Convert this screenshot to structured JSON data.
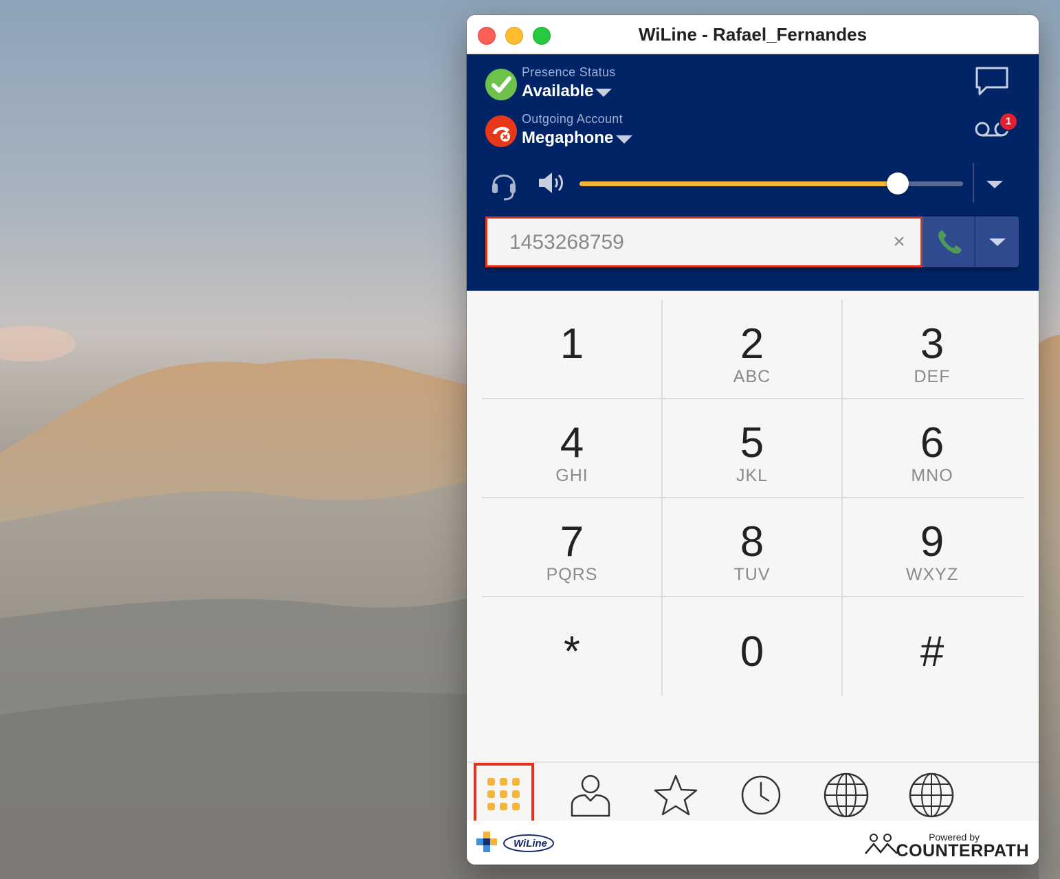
{
  "window": {
    "title": "WiLine - Rafael_Fernandes"
  },
  "presence": {
    "label": "Presence Status",
    "value": "Available",
    "icon": "check-circle-icon",
    "color": "#6cc24a"
  },
  "account": {
    "label": "Outgoing Account",
    "value": "Megaphone",
    "icon": "phone-error-icon",
    "color": "#e8381a"
  },
  "voicemail": {
    "badge": "1"
  },
  "audio": {
    "volume_fraction": 0.83,
    "track_color": "#f5b43a"
  },
  "dial": {
    "value": "1453268759",
    "placeholder": "",
    "clear_label": "×"
  },
  "keypad": {
    "keys": [
      {
        "digit": "1",
        "letters": ""
      },
      {
        "digit": "2",
        "letters": "ABC"
      },
      {
        "digit": "3",
        "letters": "DEF"
      },
      {
        "digit": "4",
        "letters": "GHI"
      },
      {
        "digit": "5",
        "letters": "JKL"
      },
      {
        "digit": "6",
        "letters": "MNO"
      },
      {
        "digit": "7",
        "letters": "PQRS"
      },
      {
        "digit": "8",
        "letters": "TUV"
      },
      {
        "digit": "9",
        "letters": "WXYZ"
      },
      {
        "digit": "*",
        "letters": ""
      },
      {
        "digit": "0",
        "letters": ""
      },
      {
        "digit": "#",
        "letters": ""
      }
    ]
  },
  "tabs": [
    {
      "name": "dialpad",
      "icon": "dialpad-icon",
      "active": true
    },
    {
      "name": "contacts",
      "icon": "contact-person-icon",
      "active": false
    },
    {
      "name": "favorites",
      "icon": "star-icon",
      "active": false
    },
    {
      "name": "history",
      "icon": "clock-icon",
      "active": false
    },
    {
      "name": "web-1",
      "icon": "globe-icon",
      "active": false
    },
    {
      "name": "web-2",
      "icon": "globe-icon",
      "active": false
    }
  ],
  "footer": {
    "brand": "WiLine",
    "powered_by": "Powered by",
    "vendor": "COUNTERPATH"
  },
  "colors": {
    "header_bg": "#002466",
    "accent": "#f5b43a",
    "highlight": "#e4321f"
  }
}
